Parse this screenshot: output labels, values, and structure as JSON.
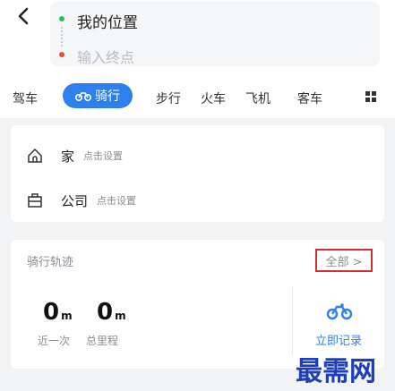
{
  "route": {
    "from": "我的位置",
    "to_placeholder": "输入终点"
  },
  "tabs": {
    "items": [
      "驾车",
      "骑行",
      "步行",
      "火车",
      "飞机",
      "客车"
    ],
    "active": "骑行"
  },
  "places": [
    {
      "name": "家",
      "hint": "点击设置",
      "icon": "home-icon"
    },
    {
      "name": "公司",
      "hint": "点击设置",
      "icon": "briefcase-icon"
    }
  ],
  "track": {
    "title": "骑行轨迹",
    "all_label": "全部 >",
    "recent": {
      "value": "0",
      "unit": "m",
      "label": "近一次"
    },
    "total": {
      "value": "0",
      "unit": "m",
      "label": "总里程"
    },
    "record_label": "立即记录"
  },
  "watermark": "最需网",
  "colors": {
    "accent": "#2f80ed",
    "start_dot": "#21c15b",
    "end_dot": "#f0493f",
    "highlight_box": "#d32f2f"
  }
}
